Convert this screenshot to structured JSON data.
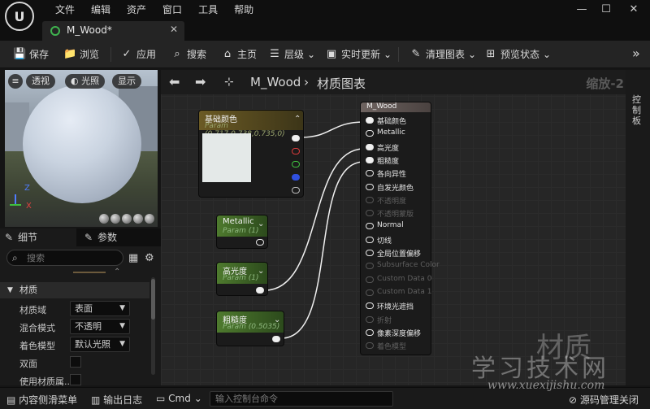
{
  "app": {
    "logo": "U"
  },
  "menu": [
    "文件",
    "编辑",
    "资产",
    "窗口",
    "工具",
    "帮助"
  ],
  "window_controls": {
    "minimize": "—",
    "maximize": "☐",
    "close": "✕"
  },
  "document_tab": {
    "label": "M_Wood*",
    "close": "✕"
  },
  "toolbar": {
    "save": "保存",
    "browse": "浏览",
    "apply": "应用",
    "search": "搜索",
    "home": "主页",
    "hierarchy": "层级",
    "live_update": "实时更新",
    "clean_graph": "清理图表",
    "preview_state": "预览状态",
    "overflow": "»"
  },
  "viewport": {
    "perspective": "透视",
    "lit": "光照",
    "show": "显示",
    "axis_z": "Z",
    "axis_x": "X",
    "axis_y": "Y"
  },
  "details": {
    "tab_details": "细节",
    "tab_params": "参数",
    "search_placeholder": "搜索",
    "section": "材质",
    "props": [
      {
        "label": "材质域",
        "value": "表面"
      },
      {
        "label": "混合模式",
        "value": "不透明"
      },
      {
        "label": "着色模型",
        "value": "默认光照"
      },
      {
        "label": "双面",
        "value": ""
      },
      {
        "label": "使用材质属...",
        "value": ""
      }
    ]
  },
  "graph": {
    "breadcrumb_asset": "M_Wood",
    "breadcrumb_sep": "›",
    "breadcrumb_graph": "材质图表",
    "zoom": "缩放-2",
    "base_color_node": {
      "title": "基础颜色",
      "param": "Param (0.717,0.738,0.735,0)",
      "swatch": "#e4e9e8"
    },
    "metallic_node": {
      "title": "Metallic",
      "param": "Param (1)"
    },
    "specular_node": {
      "title": "高光度",
      "param": "Param (1)"
    },
    "roughness_node": {
      "title": "粗糙度",
      "param": "Param (0.5035)"
    },
    "material_node": {
      "title": "M_Wood",
      "inputs": [
        {
          "label": "基础颜色",
          "active": true,
          "filled": true
        },
        {
          "label": "Metallic",
          "active": true,
          "filled": false
        },
        {
          "label": "高光度",
          "active": true,
          "filled": true
        },
        {
          "label": "粗糙度",
          "active": true,
          "filled": true
        },
        {
          "label": "各向异性",
          "active": true,
          "filled": false
        },
        {
          "label": "自发光颜色",
          "active": true,
          "filled": false
        },
        {
          "label": "不透明度",
          "active": false,
          "filled": false
        },
        {
          "label": "不透明蒙版",
          "active": false,
          "filled": false
        },
        {
          "label": "Normal",
          "active": true,
          "filled": false
        },
        {
          "label": "切线",
          "active": true,
          "filled": false
        },
        {
          "label": "全局位置偏移",
          "active": true,
          "filled": false
        },
        {
          "label": "Subsurface Color",
          "active": false,
          "filled": false
        },
        {
          "label": "Custom Data 0",
          "active": false,
          "filled": false
        },
        {
          "label": "Custom Data 1",
          "active": false,
          "filled": false
        },
        {
          "label": "环境光遮挡",
          "active": true,
          "filled": false
        },
        {
          "label": "折射",
          "active": false,
          "filled": false
        },
        {
          "label": "像素深度偏移",
          "active": true,
          "filled": false
        },
        {
          "label": "着色模型",
          "active": false,
          "filled": false
        }
      ]
    }
  },
  "side_panel": {
    "label": "控制板"
  },
  "statusbar": {
    "content_drawer": "内容侧滑菜单",
    "output_log": "输出日志",
    "cmd": "Cmd",
    "console_placeholder": "输入控制台命令",
    "source_control": "源码管理关闭"
  },
  "watermark": {
    "big": "材质",
    "mid": "学习技术网",
    "url": "www.xuexijishu.com"
  }
}
